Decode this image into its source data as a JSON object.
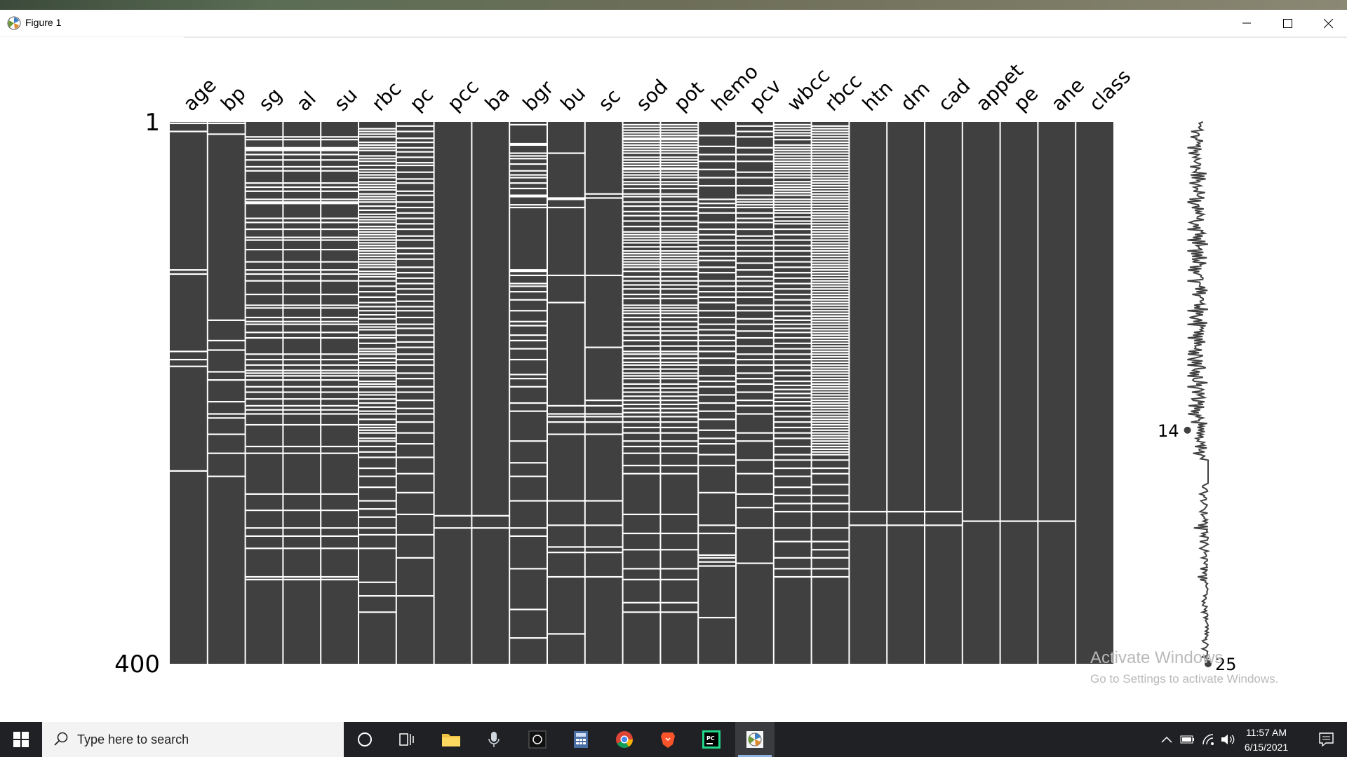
{
  "window": {
    "title": "Figure 1"
  },
  "chart_data": {
    "type": "heatmap",
    "description_type": "missing-value matrix with row sparkline",
    "columns": [
      "age",
      "bp",
      "sg",
      "al",
      "su",
      "rbc",
      "pc",
      "pcc",
      "ba",
      "bgr",
      "bu",
      "sc",
      "sod",
      "pot",
      "hemo",
      "pcv",
      "wbcc",
      "rbcc",
      "htn",
      "dm",
      "cad",
      "appet",
      "pe",
      "ane",
      "class"
    ],
    "row_range": [
      1,
      400
    ],
    "y_tick_labels": [
      "1",
      "400"
    ],
    "sparkline": {
      "min_label": "14",
      "max_label": "25",
      "min": 14,
      "max": 25
    },
    "present_color": "#404040",
    "missing_color": "#ffffff",
    "missing_rows": {
      "age": [
        2,
        8,
        110,
        113,
        170,
        176,
        181,
        258
      ],
      "bp": [
        2,
        10,
        147,
        162,
        169,
        185,
        191,
        207,
        216,
        219,
        231,
        245,
        262
      ],
      "sg": [
        12,
        14,
        20,
        21,
        22,
        25,
        29,
        34,
        37,
        46,
        49,
        52,
        58,
        60,
        61,
        72,
        75,
        80,
        86,
        88,
        95,
        104,
        110,
        113,
        118,
        128,
        136,
        138,
        145,
        148,
        150,
        156,
        160,
        172,
        176,
        180,
        184,
        186,
        188,
        191,
        196,
        200,
        205,
        210,
        213,
        216,
        224,
        240,
        245,
        275,
        287,
        300,
        306,
        315,
        336,
        338
      ],
      "al": [
        12,
        14,
        20,
        21,
        22,
        25,
        29,
        34,
        37,
        46,
        49,
        52,
        58,
        60,
        61,
        72,
        75,
        80,
        86,
        88,
        95,
        104,
        110,
        113,
        118,
        128,
        136,
        138,
        145,
        148,
        150,
        156,
        160,
        172,
        176,
        180,
        184,
        186,
        188,
        191,
        196,
        200,
        205,
        210,
        213,
        216,
        224,
        240,
        245,
        275,
        287,
        300,
        306,
        315,
        336,
        338
      ],
      "su": [
        12,
        14,
        20,
        21,
        22,
        25,
        29,
        34,
        37,
        46,
        49,
        52,
        58,
        60,
        61,
        72,
        75,
        80,
        86,
        88,
        95,
        104,
        110,
        113,
        118,
        128,
        136,
        138,
        145,
        148,
        150,
        156,
        160,
        172,
        176,
        180,
        184,
        186,
        188,
        191,
        196,
        200,
        205,
        210,
        213,
        216,
        224,
        240,
        245,
        275,
        287,
        300,
        306,
        315,
        336,
        338
      ],
      "rbc": [
        6,
        8,
        10,
        12,
        16,
        18,
        20,
        22,
        26,
        28,
        30,
        33,
        36,
        38,
        40,
        42,
        45,
        47,
        49,
        51,
        54,
        56,
        58,
        60,
        63,
        66,
        69,
        71,
        73,
        75,
        78,
        80,
        82,
        84,
        86,
        88,
        90,
        92,
        94,
        96,
        98,
        100,
        102,
        104,
        106,
        108,
        111,
        113,
        115,
        118,
        122,
        126,
        130,
        134,
        137,
        140,
        143,
        146,
        150,
        152,
        154,
        158,
        160,
        164,
        168,
        170,
        172,
        175,
        178,
        180,
        184,
        186,
        188,
        192,
        194,
        196,
        200,
        202,
        205,
        208,
        211,
        214,
        216,
        220,
        224,
        226,
        228,
        230,
        234,
        236,
        240,
        244,
        248,
        256,
        262,
        270,
        280,
        286,
        292,
        300,
        305,
        315,
        340,
        350,
        362
      ],
      "pc": [
        4,
        8,
        13,
        16,
        20,
        23,
        27,
        31,
        33,
        38,
        43,
        46,
        52,
        55,
        60,
        64,
        68,
        72,
        76,
        80,
        85,
        88,
        94,
        98,
        102,
        108,
        112,
        116,
        120,
        124,
        128,
        133,
        137,
        140,
        145,
        150,
        153,
        158,
        163,
        167,
        172,
        176,
        180,
        186,
        190,
        196,
        200,
        206,
        212,
        216,
        222,
        230,
        238,
        248,
        260,
        274,
        290,
        305,
        322,
        350
      ],
      "pcc": [
        291,
        300
      ],
      "ba": [
        291,
        300
      ],
      "bgr": [
        3,
        17,
        18,
        24,
        26,
        28,
        32,
        37,
        40,
        42,
        46,
        50,
        55,
        56,
        62,
        64,
        110,
        111,
        114,
        120,
        122,
        126,
        132,
        140,
        148,
        151,
        158,
        162,
        168,
        176,
        187,
        190,
        196,
        208,
        214,
        236,
        252,
        262,
        280,
        300,
        306,
        330,
        360,
        381
      ],
      "bu": [
        24,
        57,
        58,
        64,
        114,
        134,
        210,
        216,
        218,
        222,
        231,
        280,
        298,
        314,
        318,
        336,
        378
      ],
      "sc": [
        54,
        57,
        114,
        167,
        206,
        210,
        216,
        218,
        222,
        231,
        280,
        298,
        314,
        318,
        336
      ],
      "sod": [
        3,
        5,
        7,
        9,
        11,
        13,
        14,
        16,
        18,
        20,
        22,
        24,
        27,
        29,
        31,
        33,
        35,
        36,
        38,
        40,
        42,
        45,
        47,
        50,
        54,
        56,
        60,
        63,
        67,
        70,
        74,
        78,
        82,
        84,
        86,
        88,
        90,
        93,
        96,
        98,
        100,
        102,
        104,
        106,
        108,
        111,
        115,
        118,
        121,
        124,
        128,
        131,
        136,
        138,
        140,
        142,
        145,
        148,
        152,
        155,
        158,
        162,
        166,
        170,
        172,
        175,
        178,
        180,
        183,
        186,
        188,
        190,
        194,
        197,
        200,
        203,
        206,
        209,
        212,
        215,
        218,
        222,
        226,
        230,
        236,
        240,
        245,
        254,
        260,
        290,
        304,
        316,
        330,
        338,
        355,
        362
      ],
      "pot": [
        3,
        5,
        7,
        9,
        11,
        13,
        14,
        16,
        18,
        20,
        22,
        24,
        27,
        29,
        31,
        33,
        35,
        36,
        38,
        40,
        42,
        45,
        47,
        50,
        54,
        56,
        60,
        63,
        67,
        70,
        74,
        78,
        82,
        84,
        86,
        88,
        90,
        93,
        96,
        98,
        100,
        102,
        104,
        106,
        108,
        111,
        115,
        118,
        121,
        124,
        128,
        131,
        136,
        138,
        140,
        142,
        145,
        148,
        152,
        155,
        158,
        162,
        166,
        170,
        172,
        175,
        178,
        180,
        183,
        186,
        188,
        190,
        194,
        197,
        200,
        203,
        206,
        209,
        212,
        215,
        218,
        222,
        226,
        230,
        236,
        240,
        245,
        254,
        260,
        290,
        304,
        316,
        330,
        338,
        355,
        362
      ],
      "hemo": [
        11,
        19,
        25,
        30,
        36,
        42,
        48,
        58,
        61,
        64,
        68,
        75,
        80,
        84,
        88,
        92,
        96,
        100,
        103,
        108,
        112,
        118,
        122,
        126,
        130,
        134,
        140,
        145,
        150,
        154,
        158,
        162,
        166,
        170,
        175,
        180,
        188,
        192,
        196,
        202,
        208,
        214,
        220,
        228,
        234,
        238,
        246,
        254,
        274,
        298,
        304,
        320,
        322,
        325,
        328,
        366
      ],
      "pcv": [
        4,
        8,
        12,
        20,
        25,
        30,
        38,
        42,
        48,
        55,
        58,
        60,
        62,
        64,
        68,
        72,
        75,
        80,
        85,
        88,
        92,
        96,
        100,
        105,
        110,
        115,
        118,
        122,
        126,
        130,
        136,
        140,
        146,
        150,
        155,
        160,
        166,
        172,
        176,
        180,
        186,
        190,
        194,
        200,
        206,
        210,
        216,
        230,
        236,
        250,
        260,
        275,
        285,
        300,
        326
      ],
      "wbcc": [
        3,
        5,
        7,
        9,
        11,
        14,
        18,
        20,
        22,
        24,
        26,
        28,
        30,
        32,
        34,
        36,
        38,
        40,
        42,
        45,
        47,
        49,
        51,
        53,
        55,
        58,
        60,
        62,
        64,
        66,
        68,
        71,
        74,
        76,
        80,
        84,
        88,
        92,
        96,
        100,
        104,
        108,
        112,
        116,
        120,
        124,
        128,
        132,
        136,
        140,
        144,
        147,
        150,
        153,
        156,
        160,
        164,
        168,
        172,
        176,
        180,
        184,
        188,
        192,
        195,
        198,
        201,
        204,
        207,
        210,
        214,
        218,
        222,
        226,
        230,
        234,
        240,
        246,
        250,
        256,
        262,
        270,
        276,
        282,
        288,
        300,
        310,
        322,
        330,
        336
      ],
      "rbcc": [
        4,
        6,
        8,
        10,
        12,
        14,
        16,
        18,
        20,
        22,
        24,
        26,
        28,
        30,
        32,
        34,
        36,
        38,
        40,
        42,
        44,
        46,
        48,
        50,
        52,
        54,
        56,
        58,
        60,
        62,
        64,
        66,
        68,
        70,
        72,
        74,
        76,
        78,
        80,
        82,
        84,
        86,
        88,
        90,
        92,
        94,
        96,
        98,
        100,
        102,
        104,
        106,
        108,
        110,
        112,
        114,
        116,
        118,
        120,
        122,
        124,
        126,
        128,
        130,
        132,
        134,
        136,
        138,
        140,
        142,
        144,
        146,
        148,
        150,
        152,
        154,
        156,
        158,
        160,
        162,
        164,
        166,
        168,
        170,
        172,
        174,
        176,
        178,
        180,
        182,
        184,
        186,
        188,
        190,
        192,
        194,
        196,
        198,
        200,
        202,
        204,
        206,
        208,
        210,
        212,
        214,
        216,
        218,
        220,
        222,
        224,
        226,
        228,
        230,
        232,
        234,
        236,
        238,
        240,
        242,
        244,
        246,
        250,
        256,
        260,
        268,
        276,
        282,
        288,
        300,
        310,
        316,
        322,
        330,
        336
      ],
      "htn": [
        288,
        298
      ],
      "dm": [
        288,
        298
      ],
      "cad": [
        288,
        298
      ],
      "appet": [
        295
      ],
      "pe": [
        295
      ],
      "ane": [
        295
      ],
      "class": []
    }
  },
  "watermark": {
    "line1": "Activate Windows",
    "line2": "Go to Settings to activate Windows."
  },
  "taskbar": {
    "search_placeholder": "Type here to search",
    "time": "11:57 AM",
    "date": "6/15/2021"
  }
}
